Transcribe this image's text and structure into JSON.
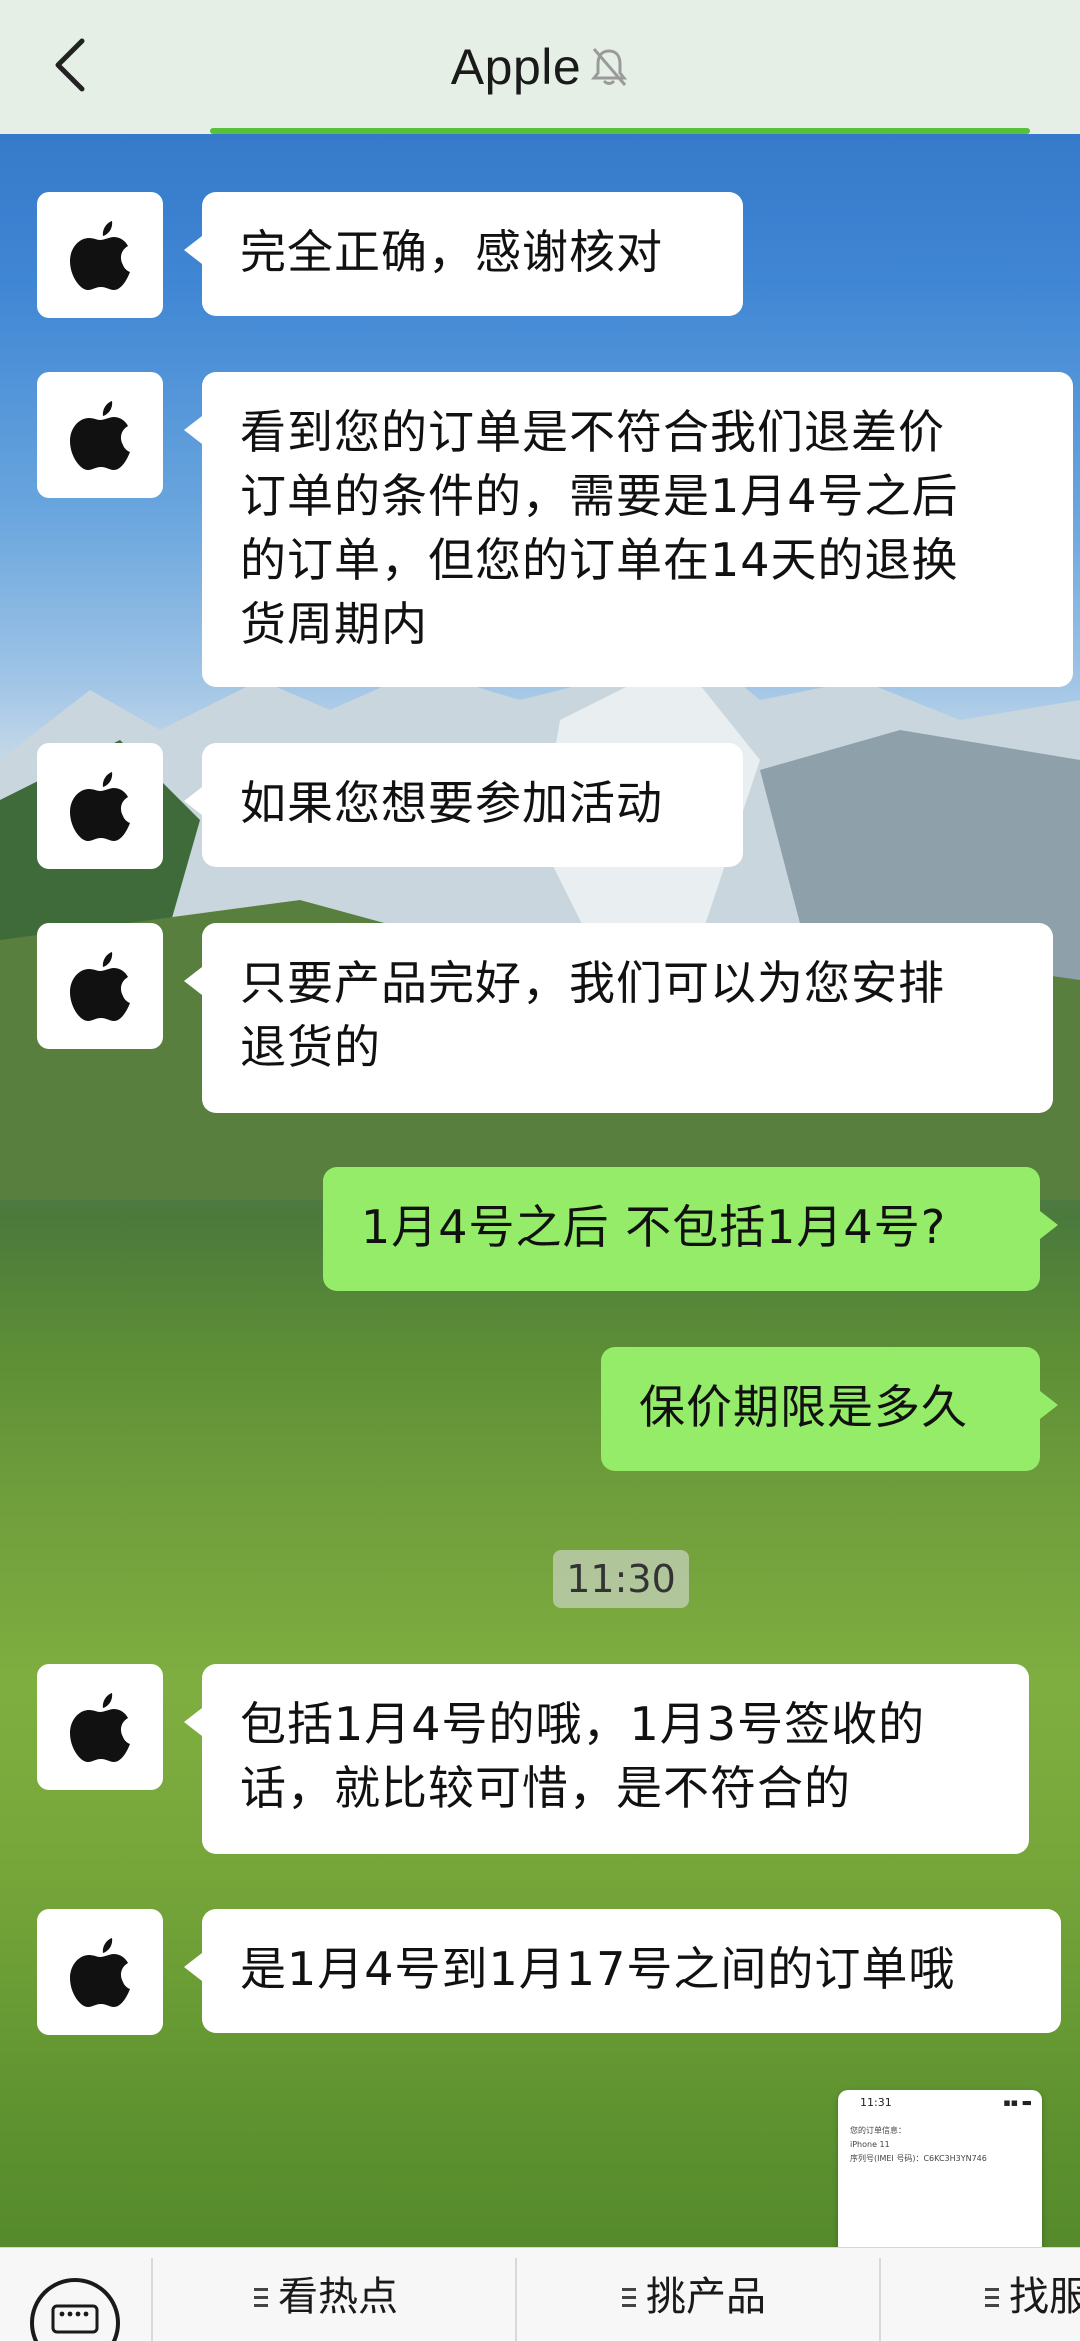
{
  "header": {
    "title": "Apple",
    "icons": {
      "back": "chevron-left-icon",
      "mute": "bell-muted-icon"
    }
  },
  "messages": [
    {
      "side": "left",
      "text": "完全正确，感谢核对"
    },
    {
      "side": "left",
      "lines": [
        "看到您的订单是不符合我们退差价",
        "订单的条件的，需要是1月4号之后",
        "的订单，但您的订单在14天的退换",
        "货周期内"
      ]
    },
    {
      "side": "left",
      "text": "如果您想要参加活动"
    },
    {
      "side": "left",
      "lines": [
        "只要产品完好，我们可以为您安排",
        "退货的"
      ]
    },
    {
      "side": "right",
      "text": "1月4号之后 不包括1月4号?"
    },
    {
      "side": "right",
      "text": "保价期限是多久"
    },
    {
      "side": "left",
      "lines": [
        "包括1月4号的哦，1月3号签收的",
        "话，就比较可惜，是不符合的"
      ]
    },
    {
      "side": "left",
      "text": "是1月4号到1月17号之间的订单哦"
    }
  ],
  "timestamp": "11:30",
  "avatar_icon": "apple-logo-icon",
  "thumbnail": {
    "time": "11:31",
    "line1": "您的订单信息：",
    "line2": "iPhone 11",
    "line3": "序列号(IMEI 号码)：C6KC3H3YN746"
  },
  "bottom_menu": {
    "keyboard_icon": "keyboard-icon",
    "items": [
      "看热点",
      "挑产品",
      "找服务"
    ]
  },
  "colors": {
    "header_bg": "#e6efe6",
    "accent_green": "#58c13a",
    "right_bubble": "#95ec69",
    "left_bubble": "#ffffff"
  }
}
